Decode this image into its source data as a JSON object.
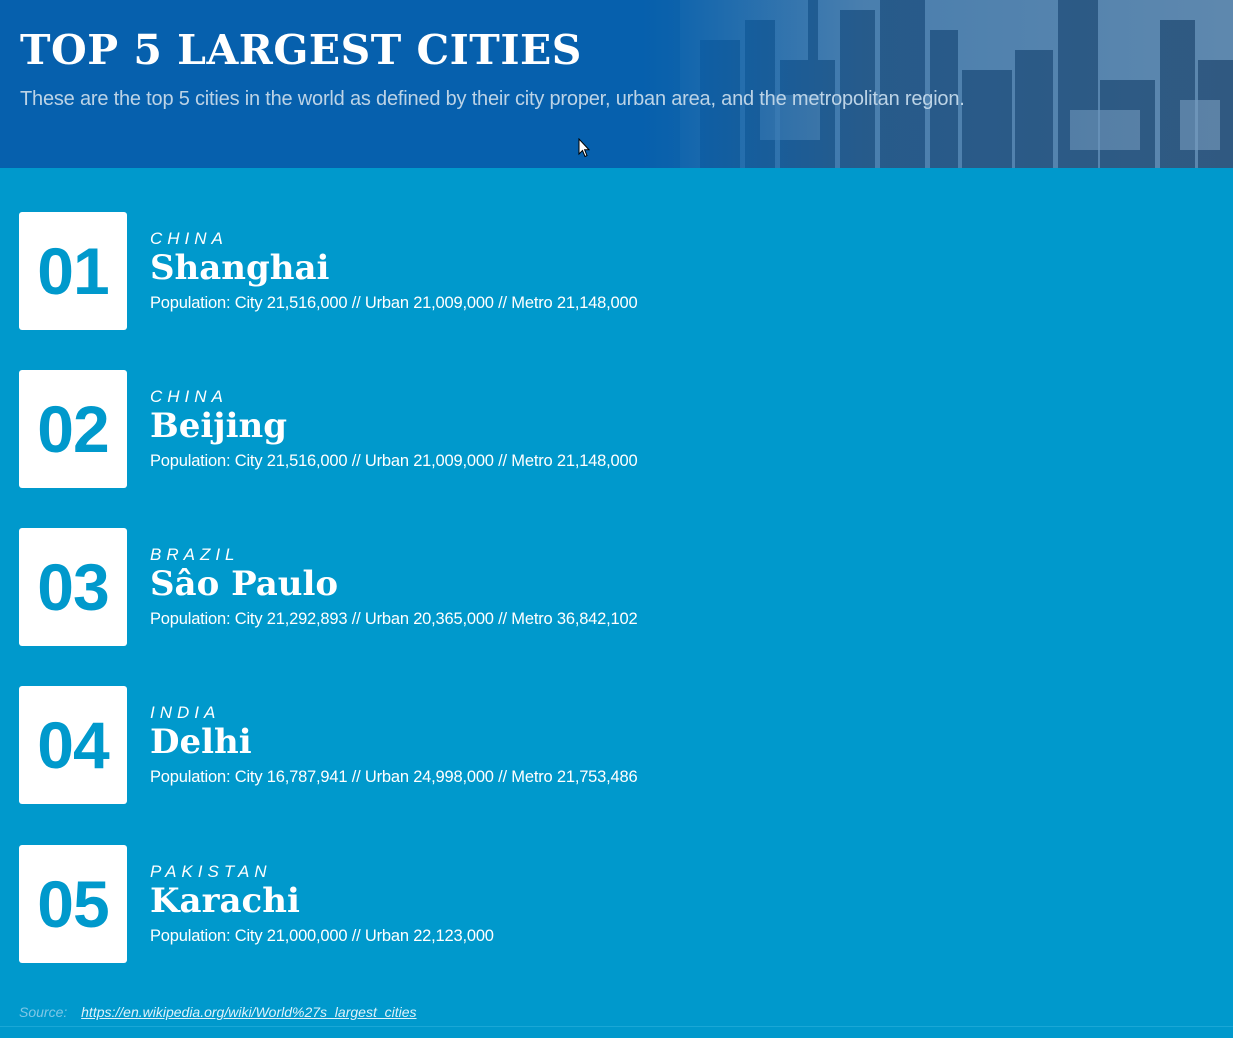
{
  "header": {
    "title": "TOP 5 LARGEST CITIES",
    "subtitle": "These are the top 5 cities in the world as defined by their city proper, urban area, and the metropolitan region."
  },
  "cities": [
    {
      "rank": "01",
      "country": "CHINA",
      "name": "Shanghai",
      "population": "Population: City 21,516,000 // Urban 21,009,000 // Metro 21,148,000"
    },
    {
      "rank": "02",
      "country": "CHINA",
      "name": "Beijing",
      "population": "Population: City 21,516,000 // Urban 21,009,000 // Metro 21,148,000"
    },
    {
      "rank": "03",
      "country": "BRAZIL",
      "name": "Sâo Paulo",
      "population": "Population: City 21,292,893 // Urban 20,365,000 // Metro 36,842,102"
    },
    {
      "rank": "04",
      "country": "INDIA",
      "name": "Delhi",
      "population": "Population: City 16,787,941 // Urban 24,998,000 // Metro 21,753,486"
    },
    {
      "rank": "05",
      "country": "PAKISTAN",
      "name": "Karachi",
      "population": "Population: City 21,000,000 // Urban 22,123,000"
    }
  ],
  "source": {
    "label": "Source:",
    "link": "https://en.wikipedia.org/wiki/World%27s_largest_cities"
  },
  "colors": {
    "background": "#0099cc",
    "header": "#0660ad",
    "rank_box": "#ffffff",
    "rank_text": "#0099cc"
  }
}
